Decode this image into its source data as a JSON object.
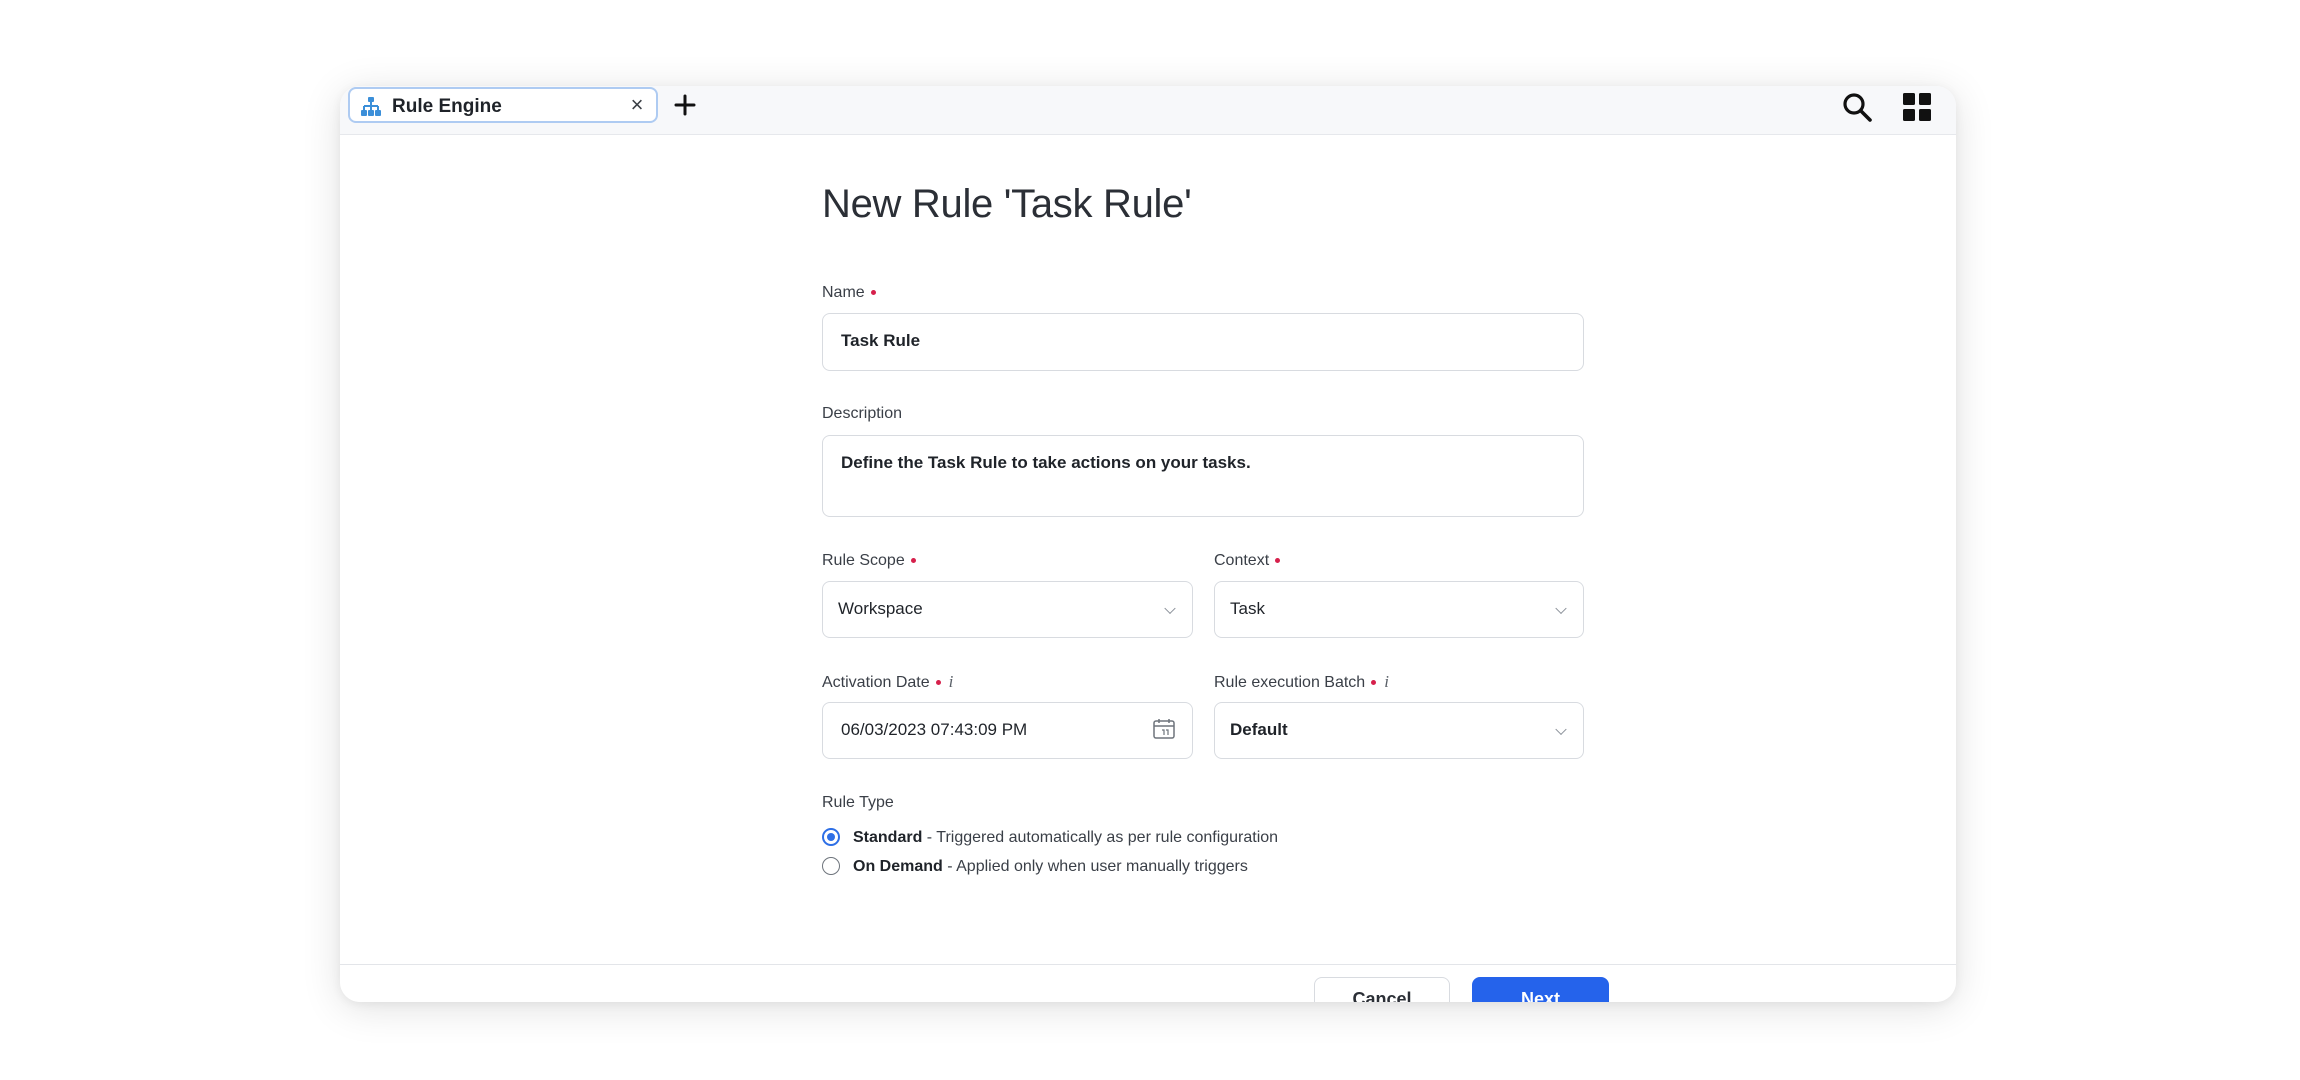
{
  "tabbar": {
    "tab_label": "Rule Engine",
    "tab_close": "×",
    "add_tab": "+"
  },
  "form": {
    "title": "New Rule 'Task Rule'",
    "name_label": "Name",
    "name_value": "Task Rule",
    "description_label": "Description",
    "description_value": "Define the Task Rule to take actions on your tasks.",
    "rule_scope_label": "Rule Scope",
    "rule_scope_value": "Workspace",
    "context_label": "Context",
    "context_value": "Task",
    "activation_date_label": "Activation Date",
    "activation_date_value": "06/03/2023 07:43:09 PM",
    "batch_label": "Rule execution Batch",
    "batch_value": "Default",
    "info_glyph": "i",
    "rule_type_label": "Rule Type",
    "rule_types": [
      {
        "name": "Standard",
        "desc": " - Triggered automatically as per rule configuration",
        "checked": true
      },
      {
        "name": "On Demand",
        "desc": " - Applied only when user manually triggers",
        "checked": false
      }
    ]
  },
  "footer": {
    "cancel_label": "Cancel",
    "next_label": "Next"
  },
  "colors": {
    "accent": "#2563eb",
    "required": "#d6204b",
    "tab_border": "#aecbf2",
    "tab_icon": "#3b8fd9"
  },
  "icons": {
    "tab_icon": "hierarchy-icon",
    "search": "search-icon",
    "apps": "grid-icon",
    "calendar": "calendar-icon"
  }
}
